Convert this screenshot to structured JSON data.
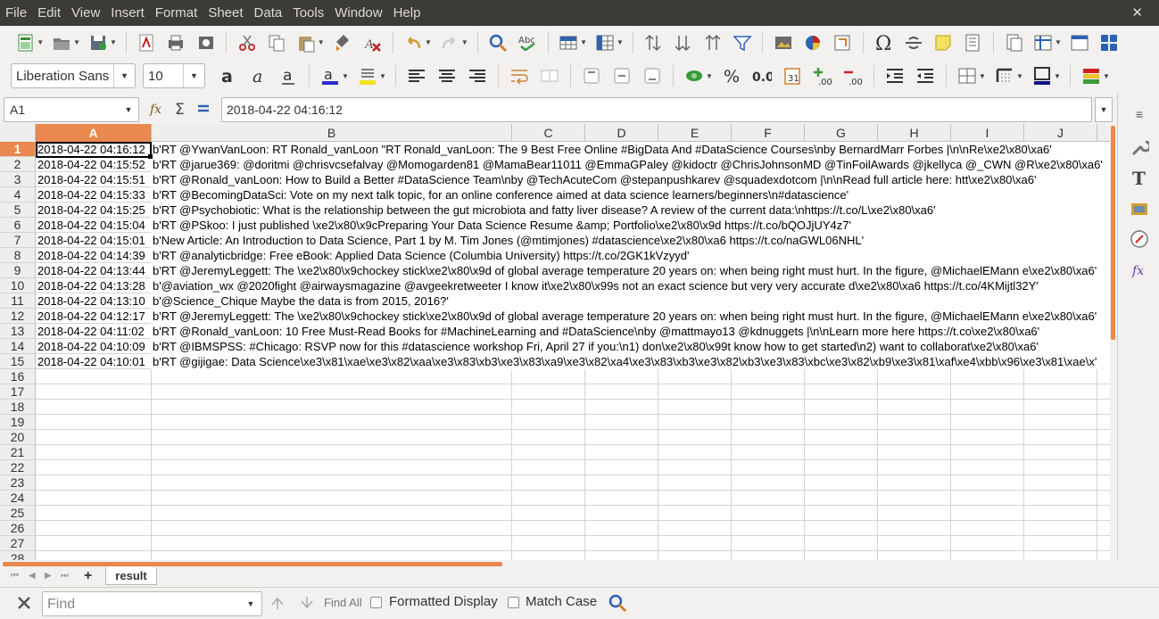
{
  "menubar": {
    "items": [
      "File",
      "Edit",
      "View",
      "Insert",
      "Format",
      "Sheet",
      "Data",
      "Tools",
      "Window",
      "Help"
    ],
    "close": "✕"
  },
  "font": {
    "name": "Liberation Sans",
    "size": "10"
  },
  "formula_bar": {
    "cell_ref": "A1",
    "content": "2018-04-22 04:16:12"
  },
  "grid": {
    "columns": [
      "A",
      "B",
      "C",
      "D",
      "E",
      "F",
      "G",
      "H",
      "I",
      "J"
    ],
    "active_column": "A",
    "row_numbers": [
      1,
      2,
      3,
      4,
      5,
      6,
      7,
      8,
      9,
      10,
      11,
      12,
      13,
      14,
      15,
      16,
      17,
      18,
      19,
      20,
      21,
      22,
      23,
      24,
      25,
      26,
      27,
      28
    ],
    "active_row": 1,
    "rows": [
      {
        "a": "2018-04-22 04:16:12",
        "b": "b'RT @YwanVanLoon: RT Ronald_vanLoon \"RT Ronald_vanLoon: The 9 Best Free Online #BigData And #DataScience Courses\\nby BernardMarr Forbes |\\n\\nRe\\xe2\\x80\\xa6'"
      },
      {
        "a": "2018-04-22 04:15:52",
        "b": "b'RT @jarue369: @doritmi @chrisvcsefalvay @Momogarden81 @MamaBear11011 @EmmaGPaley @kidoctr @ChrisJohnsonMD @TinFoilAwards @jkellyca @_CWN @R\\xe2\\x80\\xa6'"
      },
      {
        "a": "2018-04-22 04:15:51",
        "b": "b'RT @Ronald_vanLoon: How to Build a Better #DataScience Team\\nby @TechAcuteCom @stepanpushkarev @squadexdotcom |\\n\\nRead full article here: htt\\xe2\\x80\\xa6'"
      },
      {
        "a": "2018-04-22 04:15:33",
        "b": "b'RT @BecomingDataSci: Vote on my next talk topic, for an online conference aimed at data science learners/beginners\\n#datascience'"
      },
      {
        "a": "2018-04-22 04:15:25",
        "b": "b'RT @Psychobiotic: What is the relationship between the gut microbiota and fatty liver disease? A review of the current data:\\nhttps://t.co/L\\xe2\\x80\\xa6'"
      },
      {
        "a": "2018-04-22 04:15:04",
        "b": "b'RT @PSkoo: I just published \\xe2\\x80\\x9cPreparing Your Data Science Resume &amp; Portfolio\\xe2\\x80\\x9d https://t.co/bQOJjUY4z7'"
      },
      {
        "a": "2018-04-22 04:15:01",
        "b": "b'New Article: An Introduction to Data Science, Part 1 by M. Tim Jones (@mtimjones) #datascience\\xe2\\x80\\xa6 https://t.co/naGWL06NHL'"
      },
      {
        "a": "2018-04-22 04:14:39",
        "b": "b'RT @analyticbridge: Free eBook: Applied Data Science (Columbia University) https://t.co/2GK1kVzyyd'"
      },
      {
        "a": "2018-04-22 04:13:44",
        "b": "b'RT @JeremyLeggett: The \\xe2\\x80\\x9chockey stick\\xe2\\x80\\x9d of global average temperature 20 years on: when being right must hurt. In the figure, @MichaelEMann e\\xe2\\x80\\xa6'"
      },
      {
        "a": "2018-04-22 04:13:28",
        "b": "b'@aviation_wx @2020fight @airwaysmagazine @avgeekretweeter I know it\\xe2\\x80\\x99s not an exact science but very very accurate d\\xe2\\x80\\xa6 https://t.co/4KMijtl32Y'"
      },
      {
        "a": "2018-04-22 04:13:10",
        "b": "b'@Science_Chique Maybe the data is from 2015, 2016?'"
      },
      {
        "a": "2018-04-22 04:12:17",
        "b": "b'RT @JeremyLeggett: The \\xe2\\x80\\x9chockey stick\\xe2\\x80\\x9d of global average temperature 20 years on: when being right must hurt. In the figure, @MichaelEMann e\\xe2\\x80\\xa6'"
      },
      {
        "a": "2018-04-22 04:11:02",
        "b": "b'RT @Ronald_vanLoon: 10 Free Must-Read Books for #MachineLearning and #DataScience\\nby @mattmayo13 @kdnuggets |\\n\\nLearn more here https://t.co\\xe2\\x80\\xa6'"
      },
      {
        "a": "2018-04-22 04:10:09",
        "b": "b'RT @IBMSPSS: #Chicago: RSVP now for this #datascience workshop Fri, April 27 if you:\\n1) don\\xe2\\x80\\x99t know how to get started\\n2) want to collaborat\\xe2\\x80\\xa6'"
      },
      {
        "a": "2018-04-22 04:10:01",
        "b": "b'RT @gijigae: Data Science\\xe3\\x81\\xae\\xe3\\x82\\xaa\\xe3\\x83\\xb3\\xe3\\x83\\xa9\\xe3\\x82\\xa4\\xe3\\x83\\xb3\\xe3\\x82\\xb3\\xe3\\x83\\xbc\\xe3\\x82\\xb9\\xe3\\x81\\xaf\\xe4\\xbb\\x96\\xe3\\x81\\xae\\x'"
      }
    ]
  },
  "sheet_tabs": {
    "add": "+",
    "active": "result"
  },
  "find_bar": {
    "placeholder": "Find",
    "find_all": "Find All",
    "formatted_display": "Formatted Display",
    "match_case": "Match Case"
  },
  "colors": {
    "accent": "#e9884f",
    "menubar": "#3c3b37"
  }
}
